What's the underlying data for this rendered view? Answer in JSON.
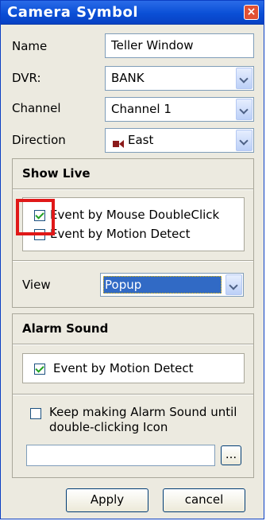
{
  "window": {
    "title": "Camera Symbol",
    "close_label": "×"
  },
  "fields": {
    "name_label": "Name",
    "name_value": "Teller Window",
    "dvr_label": "DVR:",
    "dvr_value": "BANK",
    "channel_label": "Channel",
    "channel_value": "Channel 1",
    "direction_label": "Direction",
    "direction_value": "East"
  },
  "show_live": {
    "title": "Show Live",
    "options": [
      {
        "label": "Event by Mouse DoubleClick",
        "checked": true
      },
      {
        "label": "Event by Motion Detect",
        "checked": false
      }
    ],
    "view_label": "View",
    "view_value": "Popup"
  },
  "alarm_sound": {
    "title": "Alarm Sound",
    "motion_label": "Event by Motion Detect",
    "motion_checked": true,
    "keep_line1": "Keep making Alarm Sound until",
    "keep_line2": "double-clicking Icon",
    "keep_checked": false,
    "file_value": "",
    "browse_label": "..."
  },
  "buttons": {
    "apply": "Apply",
    "cancel": "cancel"
  },
  "colors": {
    "titlebar": "#0a4fd6",
    "highlight": "#e01818",
    "selection": "#316ac5"
  }
}
